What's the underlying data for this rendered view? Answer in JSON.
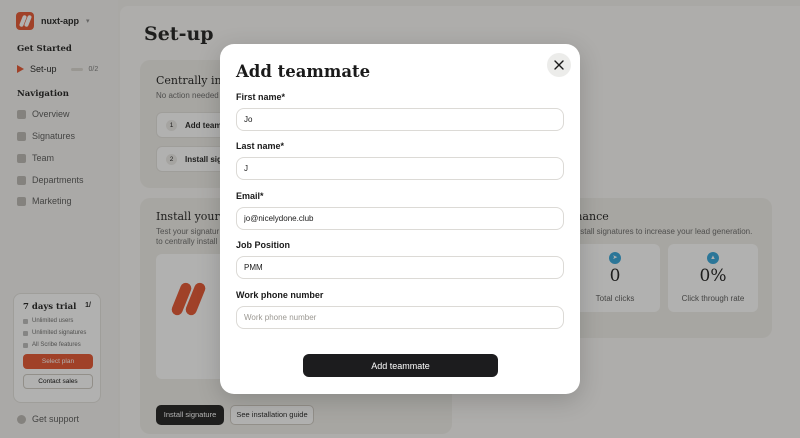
{
  "app": {
    "name": "nuxt-app"
  },
  "sidebar": {
    "get_started_title": "Get Started",
    "setup": {
      "label": "Set-up",
      "progress": "0/2"
    },
    "navigation_title": "Navigation",
    "nav_items": [
      {
        "label": "Overview",
        "icon": "home-icon"
      },
      {
        "label": "Signatures",
        "icon": "pen-icon"
      },
      {
        "label": "Team",
        "icon": "users-icon"
      },
      {
        "label": "Departments",
        "icon": "building-icon"
      },
      {
        "label": "Marketing",
        "icon": "chart-icon"
      }
    ],
    "trial": {
      "title": "7 days trial",
      "count": "1/",
      "features": [
        "Unlimited users",
        "Unlimited signatures",
        "All Scribe features"
      ],
      "select_plan": "Select plan",
      "contact_sales": "Contact sales"
    },
    "support": "Get support"
  },
  "main": {
    "title": "Set-up",
    "central_card": {
      "title": "Centrally inst",
      "subtitle": "No action needed",
      "steps": [
        {
          "num": "1",
          "label": "Add teamm"
        },
        {
          "num": "2",
          "label": "Install signa"
        }
      ]
    },
    "install_card": {
      "title": "Install your si",
      "subtitle_1": "Test your signatur",
      "subtitle_2": "to centrally install",
      "primary_btn": "Install signature",
      "secondary_btn": "See installation guide"
    },
    "performance_card": {
      "title": "mance",
      "subtitle": "install signatures to increase your lead generation.",
      "stats": [
        {
          "value": "0",
          "label": "Total clicks"
        },
        {
          "value": "0%",
          "label": "Click through rate"
        }
      ]
    }
  },
  "modal": {
    "title": "Add teammate",
    "fields": {
      "first_name": {
        "label": "First name*",
        "value": "Jo",
        "placeholder": ""
      },
      "last_name": {
        "label": "Last name*",
        "value": "J",
        "placeholder": ""
      },
      "email": {
        "label": "Email*",
        "value": "jo@nicelydone.club",
        "placeholder": ""
      },
      "job_position": {
        "label": "Job Position",
        "value": "PMM",
        "placeholder": ""
      },
      "work_phone": {
        "label": "Work phone number",
        "value": "",
        "placeholder": "Work phone number"
      }
    },
    "submit_label": "Add teammate"
  },
  "colors": {
    "accent": "#e4502b",
    "dark": "#1c1c1e",
    "stat_icon": "#2ea3d9"
  }
}
